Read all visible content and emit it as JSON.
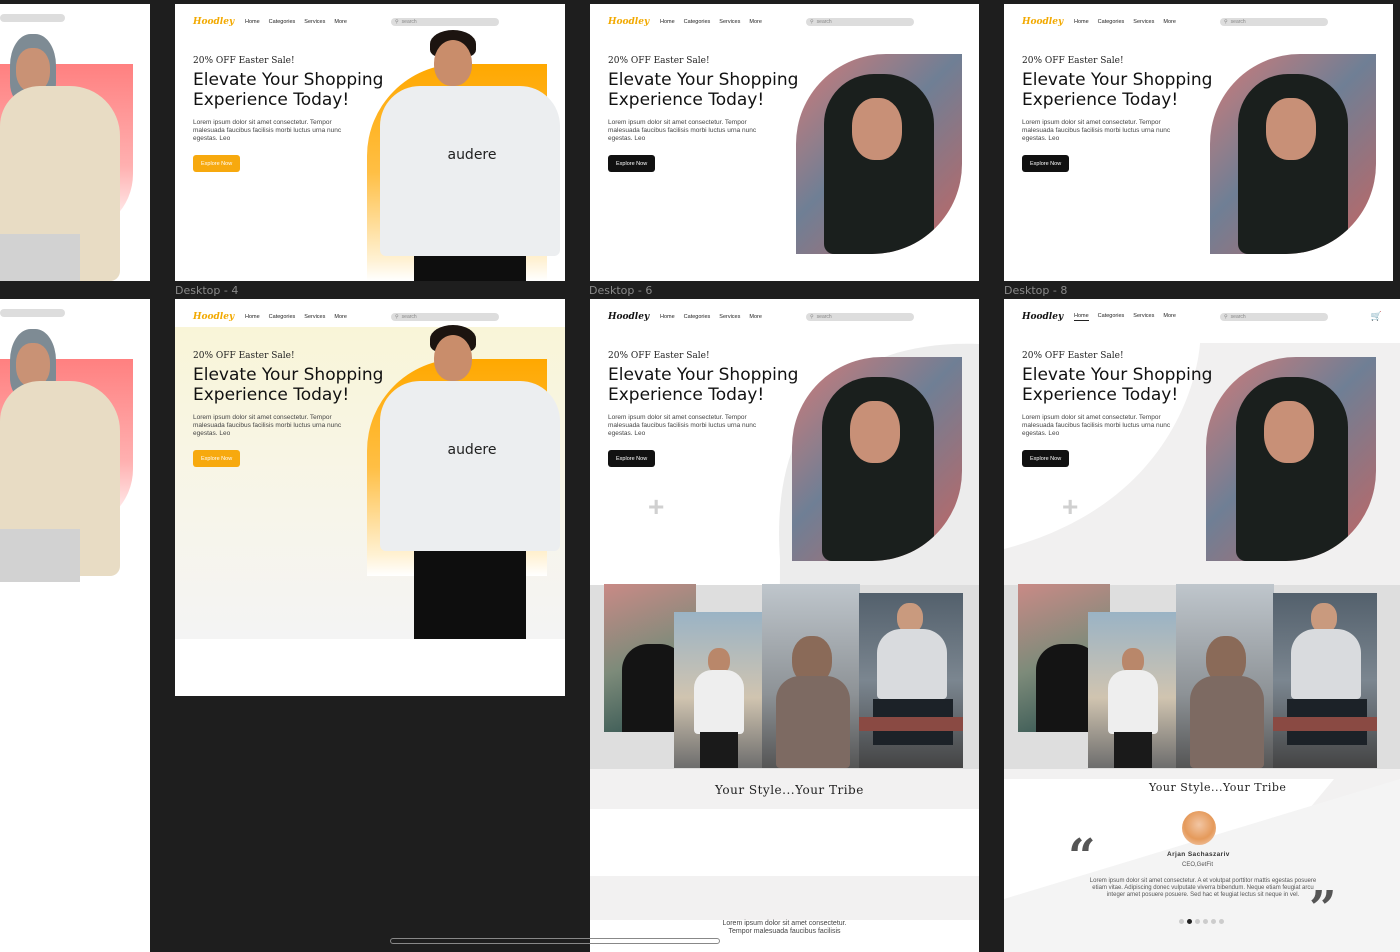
{
  "nav": {
    "logo": "Hoodley",
    "links": [
      "Home",
      "Categories",
      "Services",
      "More"
    ],
    "search_placeholder": "search"
  },
  "hero": {
    "sale": "20% OFF Easter Sale!",
    "headline": "Elevate Your Shopping Experience Today!",
    "body": "Lorem ipsum dolor sit amet consectetur. Tempor malesuada faucibus facilisis morbi luctus urna nunc egestas. Leo",
    "cta": "Explore Now"
  },
  "labels": {
    "desktop4": "Desktop - 4",
    "desktop6": "Desktop - 6",
    "desktop8": "Desktop - 8"
  },
  "tribe": "Your Style...Your Tribe",
  "testimonial": {
    "name": "Arjan Sachaszariv",
    "role": "CEO,GetFit",
    "quote": "Lorem ipsum dolor sit amet consectetur. A et volutpat porttitor mattis egestas posuere etiam vitae. Adipiscing donec vulputate viverra bibendum. Neque etiam feugiat arcu integer amet posuere posuere. Sed hac et feugiat lectus sit neque in vel."
  },
  "bottom_text": "Lorem ipsum dolor sit amet consectetur. Tempor malesuada faucibus facilisis",
  "brand_on_hoodie": "audere",
  "colors": {
    "accent": "#f7a90e",
    "dark": "#111111",
    "canvas": "#1e1e1e"
  }
}
